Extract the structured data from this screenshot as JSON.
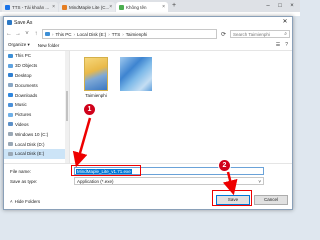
{
  "browser": {
    "tabs": [
      {
        "label": "TTS - Tài khoản ..."
      },
      {
        "label": "MindMaple Lite (C..."
      },
      {
        "label": "Không tên"
      }
    ]
  },
  "dialog": {
    "title": "Save As",
    "address": {
      "parts": [
        "This PC",
        "Local Disk (E:)",
        "TTS",
        "Taimienphi"
      ]
    },
    "search_placeholder": "Search Taimienphi",
    "organize_label": "Organize ▾",
    "new_folder_label": "New folder",
    "nav_items": [
      {
        "label": "This PC"
      },
      {
        "label": "3D Objects"
      },
      {
        "label": "Desktop"
      },
      {
        "label": "Documents"
      },
      {
        "label": "Downloads"
      },
      {
        "label": "Music"
      },
      {
        "label": "Pictures"
      },
      {
        "label": "Videos"
      },
      {
        "label": "Windows 10 (C:)"
      },
      {
        "label": "Local Disk (D:)"
      },
      {
        "label": "Local Disk (E:)"
      }
    ],
    "files": [
      {
        "name": "Taimienphi"
      },
      {
        "name": ""
      }
    ],
    "file_name_label": "File name:",
    "file_name_value": "MindMaple_Lite_v1.71.exe",
    "save_type_label": "Save as type:",
    "save_type_value": "Application (*.exe)",
    "hide_folders_label": "Hide Folders",
    "save_label": "Save",
    "cancel_label": "Cancel"
  },
  "annotations": {
    "badge1": "1",
    "badge2": "2"
  },
  "colors": {
    "accent": "#0078d7",
    "annotation_red": "#d0021b"
  }
}
